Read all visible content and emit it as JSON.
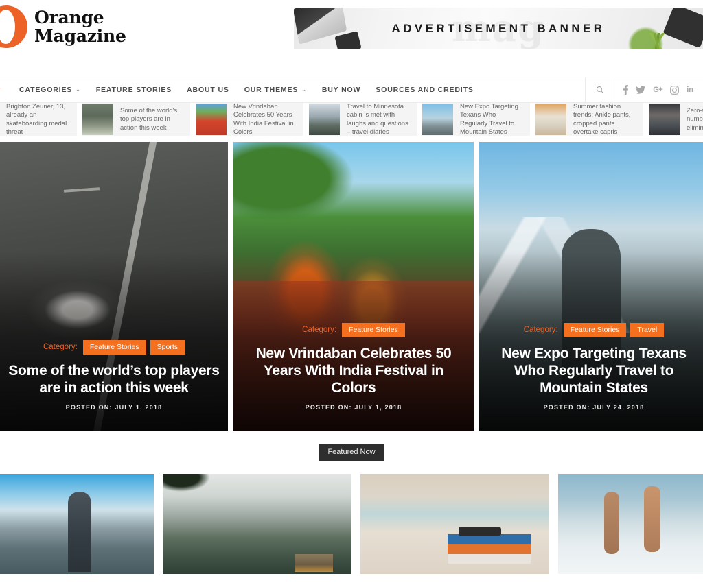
{
  "site": {
    "logo_text": "Orange\nMagazine",
    "accent_color": "#f4701f",
    "logo_mark": "orange-o"
  },
  "ad": {
    "text": "ADVERTISEMENT BANNER",
    "watermark": "mag"
  },
  "nav": {
    "items": [
      {
        "label": "CATEGORIES",
        "caret": "⌄"
      },
      {
        "label": "FEATURE STORIES",
        "caret": ""
      },
      {
        "label": "ABOUT US",
        "caret": ""
      },
      {
        "label": "OUR THEMES",
        "caret": "⌄"
      },
      {
        "label": "BUY NOW",
        "caret": ""
      },
      {
        "label": "SOURCES AND CREDITS",
        "caret": ""
      }
    ],
    "socials": [
      {
        "name": "facebook-icon",
        "glyph": "f"
      },
      {
        "name": "twitter-icon",
        "glyph": "✉"
      },
      {
        "name": "google-plus-icon",
        "glyph": "G+"
      },
      {
        "name": "instagram-icon",
        "glyph": "◎"
      },
      {
        "name": "linkedin-icon",
        "glyph": "in"
      }
    ]
  },
  "ticker": {
    "items": [
      {
        "title": "Brighton Zeuner, 13, already an skateboarding medal threat",
        "thumb": ""
      },
      {
        "title": "Some of the world's top players are in action this week",
        "thumb": "th-skate"
      },
      {
        "title": "New Vrindaban Celebrates 50 Years With India Festival in Colors",
        "thumb": "th-holi"
      },
      {
        "title": "Travel to Minnesota cabin is met with laughs and questions – travel diaries",
        "thumb": "th-lake"
      },
      {
        "title": "New Expo Targeting Texans Who Regularly Travel to Mountain States",
        "thumb": "th-mtn"
      },
      {
        "title": "Summer fashion trends: Ankle pants, cropped pants overtake capris",
        "thumb": "th-car"
      },
      {
        "title": "Zero-waste life: number of people eliminating tra",
        "thumb": "th-fash"
      }
    ]
  },
  "hero": {
    "category_label": "Category:",
    "cards": [
      {
        "title": "Some of the world’s top players are in action this week",
        "categories": [
          "Feature Stories",
          "Sports"
        ],
        "date": "POSTED ON: JULY 1, 2018",
        "image": "woman-sitting-on-track"
      },
      {
        "title": "New Vrindaban Celebrates 50 Years With India Festival in Colors",
        "categories": [
          "Feature Stories"
        ],
        "date": "POSTED ON: JULY 1, 2018",
        "image": "holi-festival-women"
      },
      {
        "title": "New Expo Targeting Texans Who Regularly Travel to Mountain States",
        "categories": [
          "Feature Stories",
          "Travel"
        ],
        "date": "POSTED ON: JULY 24, 2018",
        "image": "hiker-mountains"
      }
    ]
  },
  "featured": {
    "heading": "Featured Now",
    "tiles": [
      {
        "image": "hiker-overlooking-alps"
      },
      {
        "image": "mountain-lake-cabin"
      },
      {
        "image": "beach-books-sunglasses"
      },
      {
        "image": "women-running-into-ocean"
      }
    ]
  }
}
